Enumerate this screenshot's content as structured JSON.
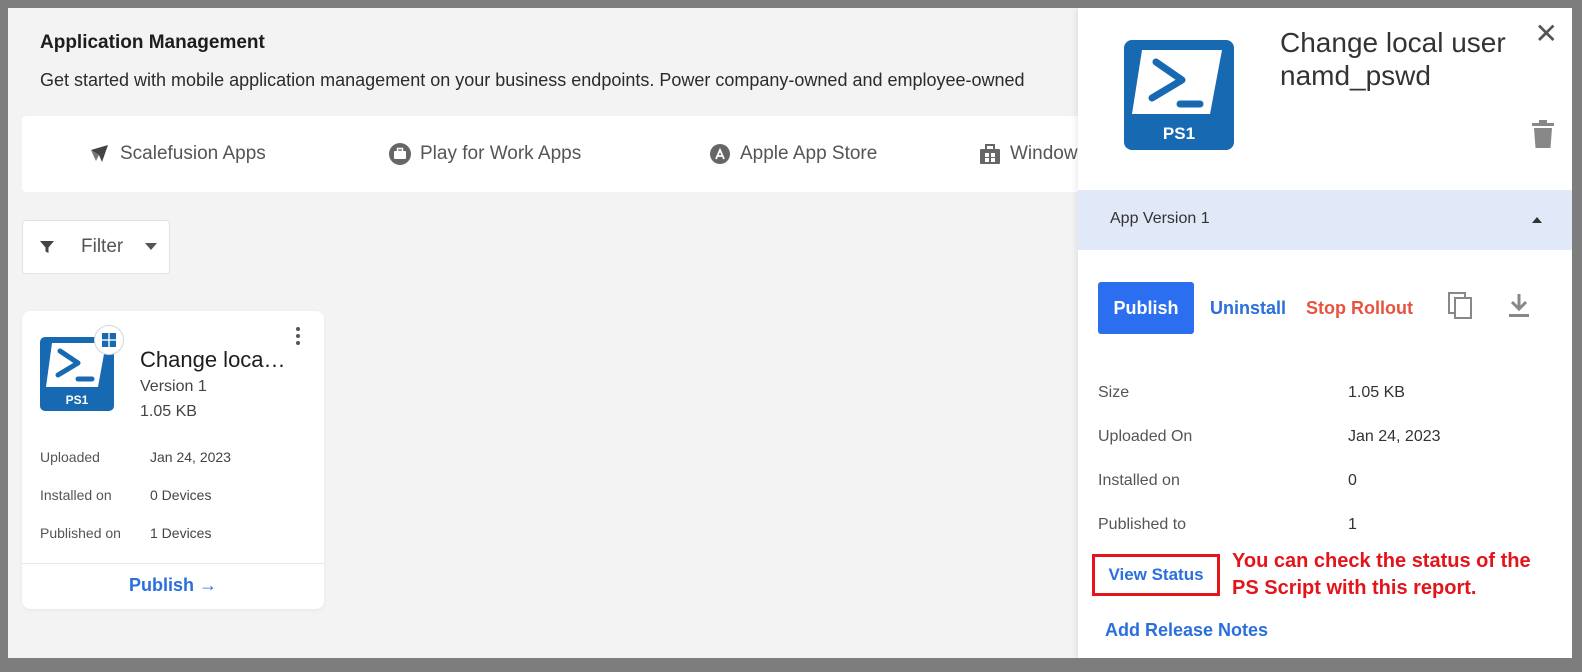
{
  "page": {
    "title": "Application Management",
    "description": "Get started with mobile application management on your business endpoints. Power company-owned and employee-owned"
  },
  "store_tabs": [
    {
      "label": "Scalefusion Apps",
      "icon": "scalefusion-icon"
    },
    {
      "label": "Play for Work Apps",
      "icon": "briefcase-icon"
    },
    {
      "label": "Apple App Store",
      "icon": "app-store-icon"
    },
    {
      "label": "Windows",
      "icon": "windows-store-icon"
    }
  ],
  "filter": {
    "label": "Filter"
  },
  "app_card": {
    "icon_text": "PS1",
    "title": "Change local user namd_pswd",
    "version": "Version 1",
    "size": "1.05 KB",
    "rows": [
      {
        "label": "Uploaded",
        "value": "Jan 24, 2023"
      },
      {
        "label": "Installed on",
        "value": "0 Devices"
      },
      {
        "label": "Published on",
        "value": "1 Devices"
      }
    ],
    "publish_label": "Publish",
    "publish_arrow": "→"
  },
  "panel": {
    "icon_text": "PS1",
    "title": "Change local user namd_pswd",
    "close_glyph": "✕",
    "version_label": "App Version 1",
    "actions": {
      "publish": "Publish",
      "uninstall": "Uninstall",
      "stop_rollout": "Stop Rollout"
    },
    "details": [
      {
        "label": "Size",
        "value": "1.05 KB"
      },
      {
        "label": "Uploaded On",
        "value": "Jan 24, 2023"
      },
      {
        "label": "Installed on",
        "value": "0"
      },
      {
        "label": "Published to",
        "value": "1"
      }
    ],
    "view_status": "View Status",
    "annotation": "You can check the status of the PS Script with this report.",
    "add_release_notes": "Add Release Notes"
  },
  "colors": {
    "accent": "#2b6ef0",
    "link": "#2a6fdb",
    "danger": "#e8533f",
    "annotation": "#e3141b",
    "ps_icon": "#1769b1",
    "version_bar": "#e1e8f7"
  }
}
